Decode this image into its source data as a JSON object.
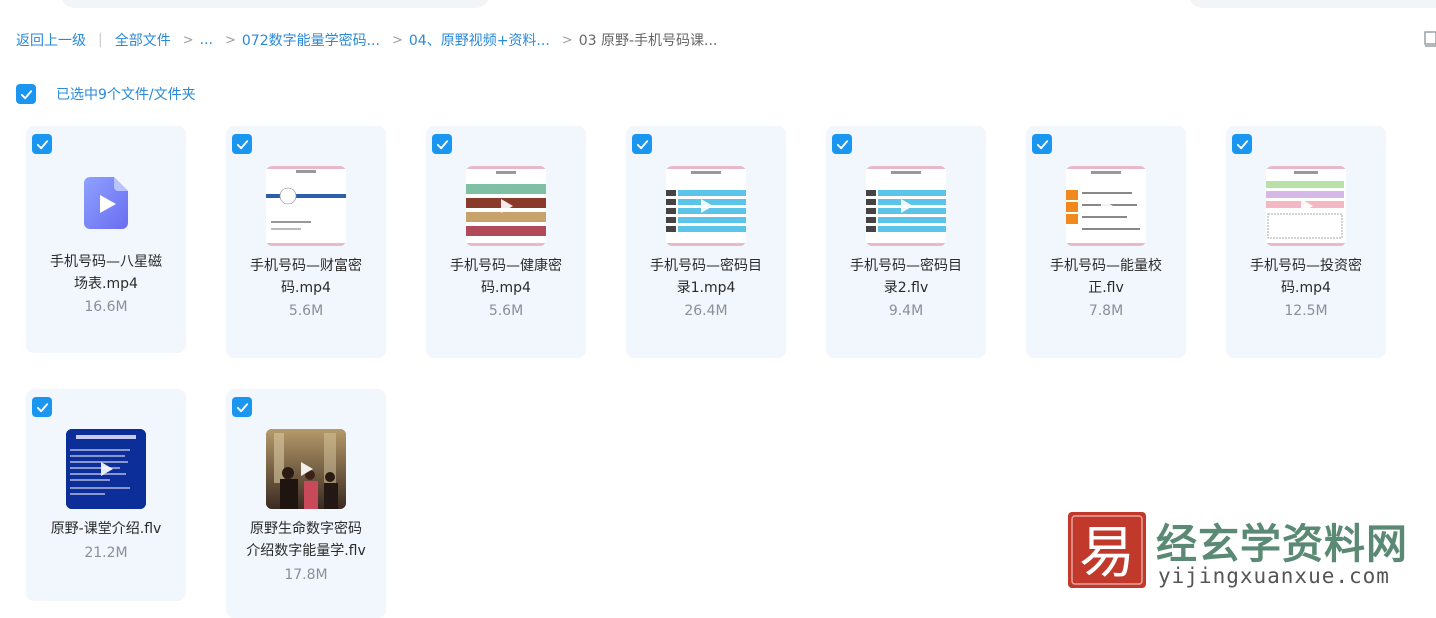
{
  "breadcrumb": {
    "back": "返回上一级",
    "all_files": "全部文件",
    "ellipsis": "...",
    "level1": "072数字能量学密码...",
    "level2": "04、原野视频+资料...",
    "current": "03 原野-手机号码课..."
  },
  "selection": {
    "text": "已选中9个文件/文件夹"
  },
  "files": [
    {
      "name_line1": "手机号码—八星磁",
      "name_line2": "场表.mp4",
      "size": "16.6M",
      "thumb": "video-icon"
    },
    {
      "name_line1": "手机号码—财富密",
      "name_line2": "码.mp4",
      "size": "5.6M",
      "thumb": "slide"
    },
    {
      "name_line1": "手机号码—健康密",
      "name_line2": "码.mp4",
      "size": "5.6M",
      "thumb": "slide"
    },
    {
      "name_line1": "手机号码—密码目",
      "name_line2": "录1.mp4",
      "size": "26.4M",
      "thumb": "slide"
    },
    {
      "name_line1": "手机号码—密码目",
      "name_line2": "录2.flv",
      "size": "9.4M",
      "thumb": "slide"
    },
    {
      "name_line1": "手机号码—能量校",
      "name_line2": "正.flv",
      "size": "7.8M",
      "thumb": "slide"
    },
    {
      "name_line1": "手机号码—投资密",
      "name_line2": "码.mp4",
      "size": "12.5M",
      "thumb": "slide"
    },
    {
      "name_line1": "原野-课堂介绍.flv",
      "name_line2": "",
      "size": "21.2M",
      "thumb": "blue-screen"
    },
    {
      "name_line1": "原野生命数字密码",
      "name_line2": "介绍数字能量学.flv",
      "size": "17.8M",
      "thumb": "photo"
    }
  ],
  "watermark": {
    "title": "经玄学资料网",
    "url": "yijingxuanxue.com",
    "logo_text": "易"
  },
  "colors": {
    "accent": "#1a95f0",
    "link": "#2a8ad8",
    "card_bg": "#f2f7fd",
    "watermark_green": "#5a8a73",
    "watermark_red": "#c0392b"
  }
}
